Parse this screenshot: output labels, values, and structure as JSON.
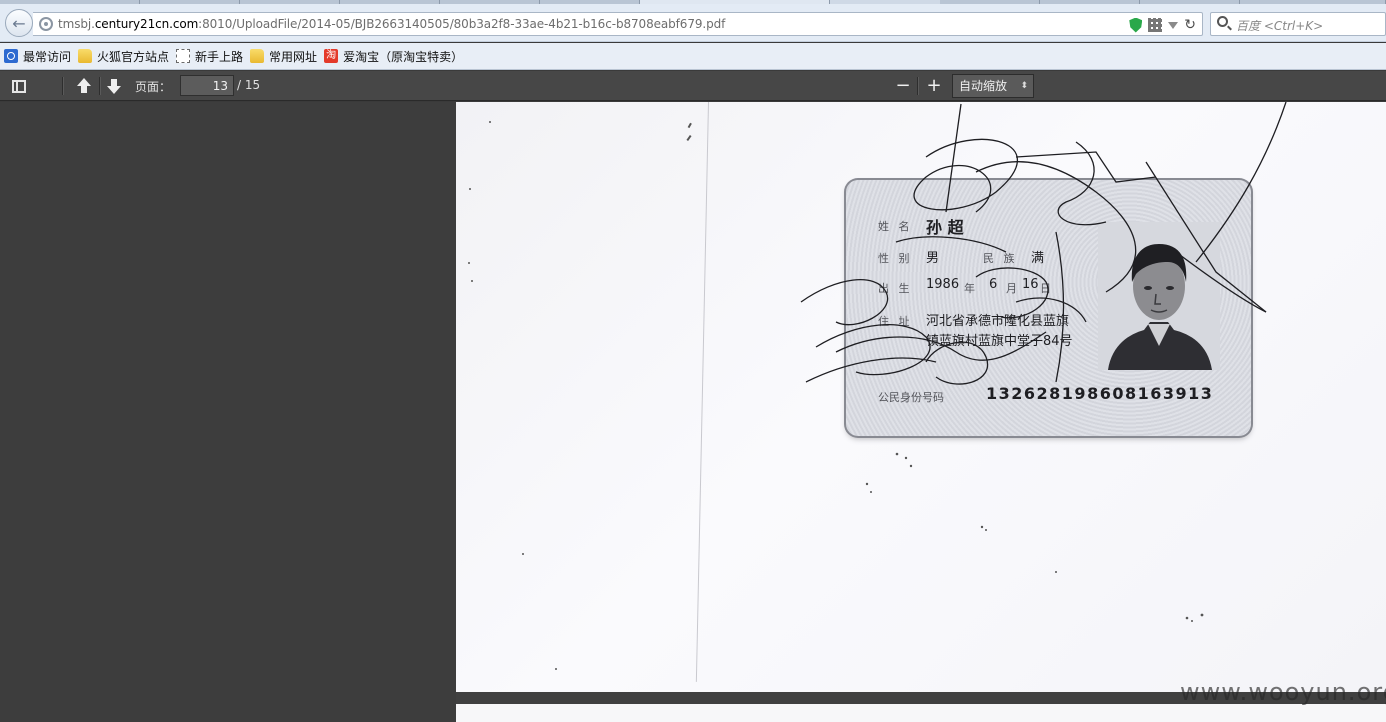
{
  "browser": {
    "url_prefix": "tmsbj.",
    "url_host": "century21cn.com",
    "url_rest": ":8010/UploadFile/2014-05/BJB2663140505/80b3a2f8-33ae-4b21-b16c-b8708eabf679.pdf",
    "search_placeholder": "百度 <Ctrl+K>"
  },
  "bookmarks": [
    {
      "label": "最常访问",
      "icon": "star-icon"
    },
    {
      "label": "火狐官方站点",
      "icon": "folder-icon"
    },
    {
      "label": "新手上路",
      "icon": "page-icon"
    },
    {
      "label": "常用网址",
      "icon": "folder-icon"
    },
    {
      "label": "爱淘宝（原淘宝特卖）",
      "icon": "taobao-icon",
      "icon_glyph": "淘"
    }
  ],
  "pdf_toolbar": {
    "page_label": "页面：",
    "current_page": "13",
    "page_total": "/ 15",
    "zoom_out": "−",
    "zoom_in": "+",
    "zoom_value": "自动缩放",
    "zoom_chevron": "⬍"
  },
  "id_card": {
    "name_label": "姓 名",
    "name_value": "孙 超",
    "sex_label": "性 别",
    "sex_value": "男",
    "ethnicity_label": "民 族",
    "ethnicity_value": "满",
    "birth_label": "出 生",
    "birth_year": "1986",
    "birth_year_unit": "年",
    "birth_month": "6",
    "birth_month_unit": "月",
    "birth_day": "16",
    "birth_day_unit": "日",
    "address_label": "住 址",
    "address_line1": "河北省承德市隆化县蓝旗",
    "address_line2": "镇蓝旗村蓝旗中堂子84号",
    "id_label": "公民身份号码",
    "id_number": "132628198608163913"
  },
  "watermark": "www.wooyun.org"
}
